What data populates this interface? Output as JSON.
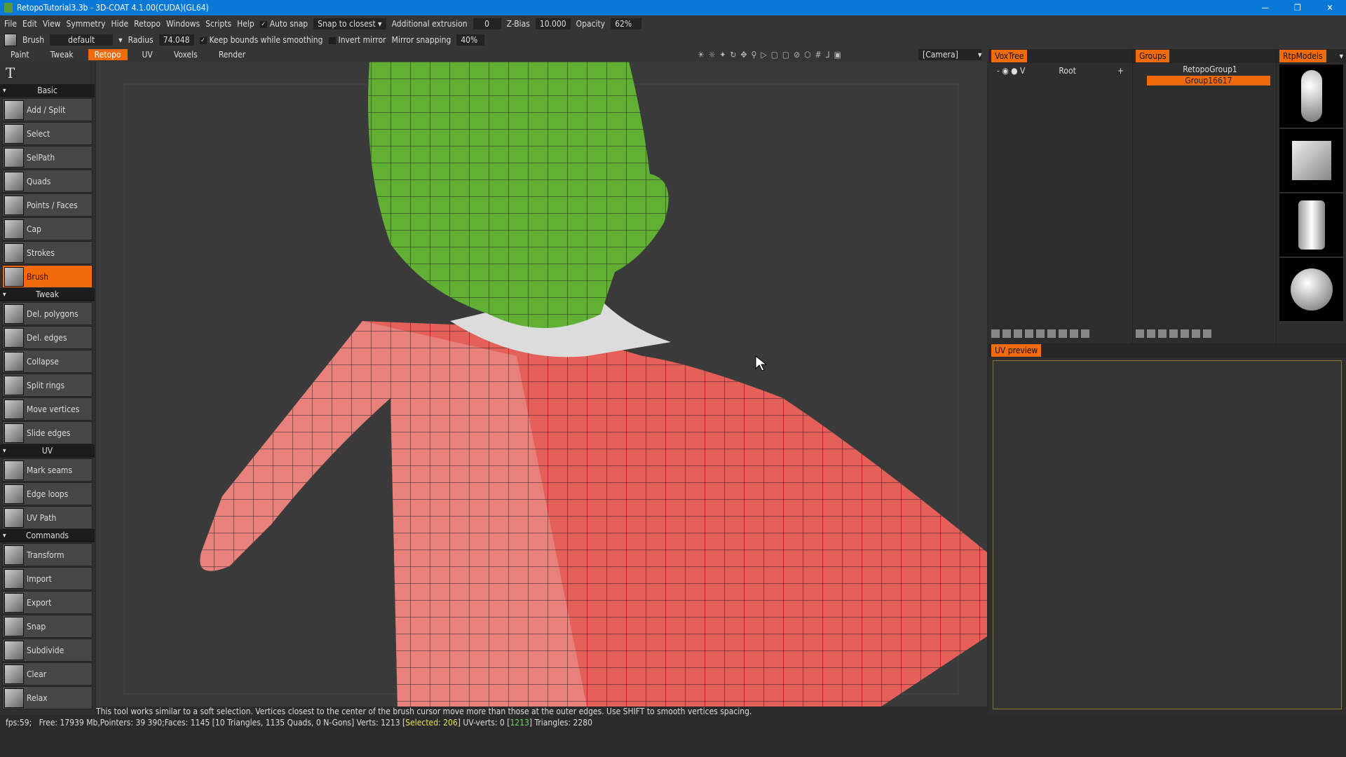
{
  "window": {
    "title": "RetopoTutorial3.3b - 3D-COAT 4.1.00(CUDA)(GL64)",
    "controls": [
      "—",
      "❐",
      "✕"
    ]
  },
  "menu": [
    "File",
    "Edit",
    "View",
    "Symmetry",
    "Hide",
    "Retopo",
    "Windows",
    "Scripts",
    "Help"
  ],
  "toolbar1": {
    "auto_snap": "Auto snap",
    "snap_mode": "Snap to closest",
    "additional_extrusion_label": "Additional extrusion",
    "additional_extrusion": "0",
    "zbias_label": "Z-Bias",
    "zbias": "10.000",
    "opacity_label": "Opacity",
    "opacity": "62%"
  },
  "toolbar2": {
    "tool": "Brush",
    "preset": "default",
    "radius_label": "Radius",
    "radius": "74.048",
    "keep_bounds": "Keep bounds while smoothing",
    "invert_mirror": "Invert mirror",
    "mirror_snapping_label": "Mirror snapping",
    "mirror_snapping": "40%"
  },
  "tabs": [
    {
      "label": "Paint"
    },
    {
      "label": "Tweak"
    },
    {
      "label": "Retopo",
      "active": true
    },
    {
      "label": "UV"
    },
    {
      "label": "Voxels"
    },
    {
      "label": "Render"
    }
  ],
  "camera": "[Camera]",
  "sections": [
    {
      "title": "Basic",
      "tools": [
        "Add / Split",
        "Select",
        "SelPath",
        "Quads",
        "Points / Faces",
        "Cap",
        "Strokes",
        "Brush"
      ]
    },
    {
      "title": "Tweak",
      "tools": [
        "Del. polygons",
        "Del. edges",
        "Collapse",
        "Split rings",
        "Move vertices",
        "Slide edges"
      ]
    },
    {
      "title": "UV",
      "tools": [
        "Mark seams",
        "Edge loops",
        "UV Path"
      ]
    },
    {
      "title": "Commands",
      "tools": [
        "Transform",
        "Import",
        "Export",
        "Snap",
        "Subdivide",
        "Clear",
        "Relax"
      ]
    }
  ],
  "active_tool": "Brush",
  "panels": {
    "voxtree": "VoxTree",
    "voxtree_root": "Root",
    "groups": "Groups",
    "group_items": [
      "RetopoGroup1",
      "Group16617"
    ],
    "selected_group": "Group16617",
    "rtpmodels": "RtpModels",
    "uv_preview": "UV preview"
  },
  "hint": "This tool works similar to a soft selection. Vertices closest to the center of the brush cursor move more than those at the outer edges. Use SHIFT to smooth vertices spacing.",
  "status": {
    "prefix": "fps:59;   Free: 17939 Mb,Pointers: 39 390;Faces: 1145 [10 Triangles, 1135 Quads, 0 N-Gons] Verts: 1213 [",
    "selected": "Selected: 206",
    "mid": "] UV-verts: 0 [",
    "uvverts": "1213",
    "suffix": "] Triangles: 2280"
  },
  "colors": {
    "accent": "#f26b0a",
    "titlebar": "#0a78d7",
    "head": "#5fb033",
    "body": "#e0534a"
  }
}
